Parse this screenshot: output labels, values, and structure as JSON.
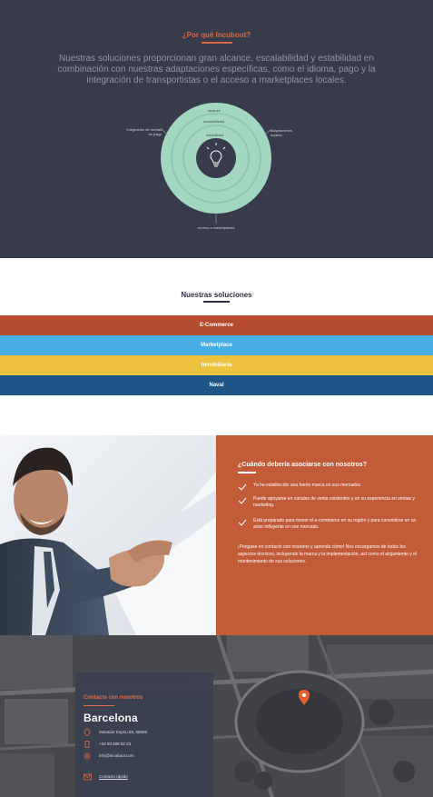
{
  "why": {
    "title": "¿Por qué Incubout?",
    "intro": "Nuestras soluciones proporcionan gran alcance, escalabilidad y estabilidad en combinación con nuestras adaptaciones específicas, como el idioma, pago y la integración de transportistas o el acceso a marketplaces locales.",
    "diagram": {
      "ring_outer": "alcance",
      "ring_middle": "escalabilidad",
      "ring_inner": "estabilidad",
      "label_left": "integración de formas de pago",
      "label_right": "adaptaciones locales",
      "label_bottom": "acceso a marketplaces",
      "center_icon": "lightbulb-icon"
    }
  },
  "solutions": {
    "title": "Nuestras soluciones",
    "bands": [
      {
        "label": "E-Commerce",
        "color": "#b44a2e"
      },
      {
        "label": "Marketplace",
        "color": "#48aee6"
      },
      {
        "label": "Inmobiliaria",
        "color": "#ecc23e"
      },
      {
        "label": "Naval",
        "color": "#1d5587"
      }
    ]
  },
  "when": {
    "title": "¿Cuándo debería asociarse con nosotros?",
    "items": [
      "Ya ha establecido una fuerte marca en sus mercados.",
      "Puede apoyarse en canales de venta existentes y en su experiencia en ventas y marketing.",
      "Está preparado para mover el e-commerce en su región y para convertirse en un actor influyente en ese mercado."
    ],
    "cta": "¡Póngase en contacto con nosotros y aprenda cómo! Nos encargamos de todos los aspectos técnicos, incluyendo la marca y la implementación, así como el alojamiento y el mantenimiento de sus soluciones."
  },
  "contact": {
    "title": "Contacte con nosotros",
    "city": "Barcelona",
    "address": "Salvador Espriu 93, 08005",
    "phone": "+34 93 488 52 23",
    "email": "info@incubout.com",
    "quick_link": "Contacto rápido"
  },
  "colors": {
    "dark_bg": "#373b4b",
    "accent": "#d4693f",
    "mint": "#a3d7c1",
    "when_bg": "#c25b38",
    "contact_bg": "#3b4052"
  }
}
